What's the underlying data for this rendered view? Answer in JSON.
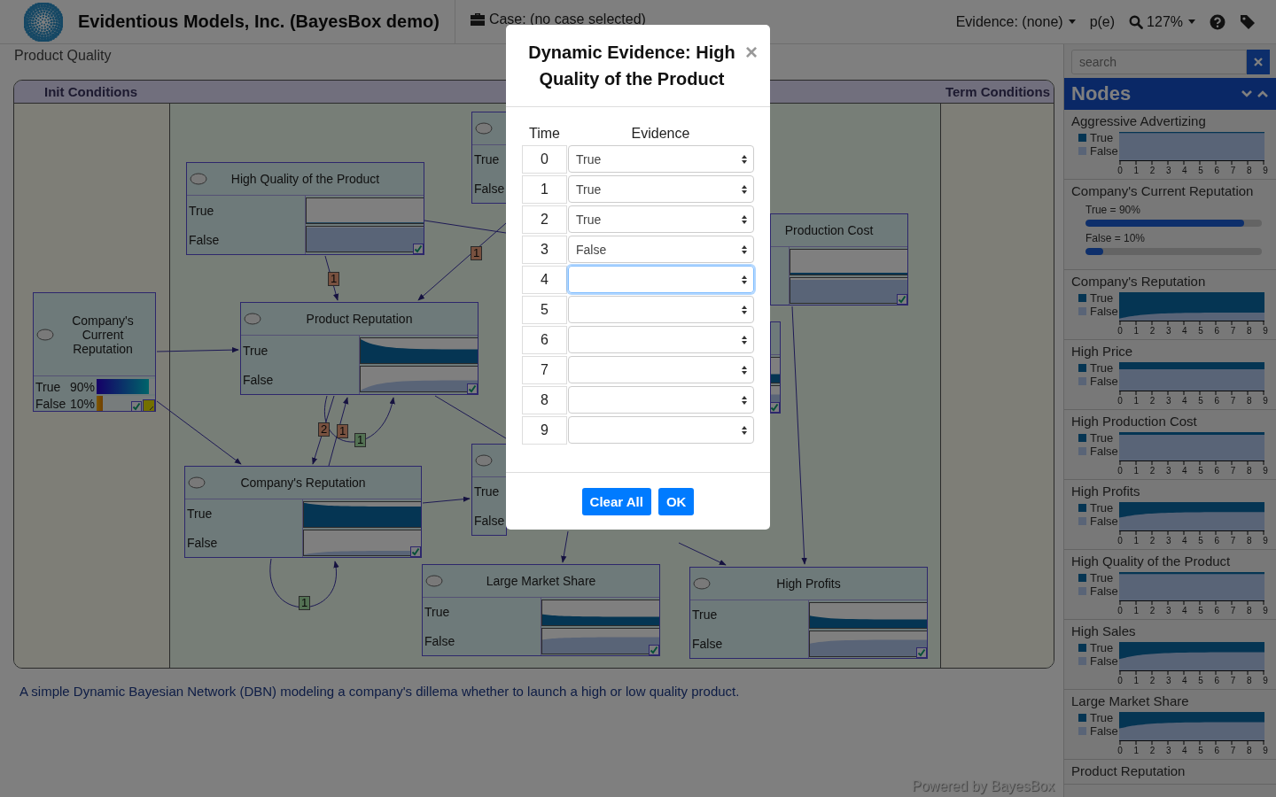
{
  "header": {
    "title": "Evidentious Models, Inc. (BayesBox demo)",
    "case": "Case: (no case selected)",
    "evidence": "Evidence: (none)",
    "pe": "p(e)",
    "zoom": "127%"
  },
  "breadcrumb": "Product Quality",
  "canvas": {
    "init_label": "Init Conditions",
    "term_label": "Term Conditions",
    "nodes": [
      {
        "kind": "chart",
        "title": "High Quality of the Product",
        "states": [
          {
            "label": "True"
          },
          {
            "label": "False"
          }
        ]
      },
      {
        "kind": "chart",
        "states": [
          {
            "label": "True"
          },
          {
            "label": "False"
          }
        ]
      },
      {
        "kind": "chart",
        "title": "Production Cost"
      },
      {
        "kind": "chart"
      },
      {
        "kind": "bars",
        "title": "Company's Current Reputation",
        "states": [
          {
            "label": "True",
            "value": "90%",
            "level": 0.9
          },
          {
            "label": "False",
            "value": "10%",
            "level": 0.1
          }
        ]
      },
      {
        "kind": "chart",
        "title": "Product Reputation",
        "states": [
          {
            "label": "True"
          },
          {
            "label": "False"
          }
        ]
      },
      {
        "kind": "chart",
        "title": "Company's Reputation",
        "states": [
          {
            "label": "True"
          },
          {
            "label": "False"
          }
        ]
      },
      {
        "kind": "chart",
        "states": [
          {
            "label": "True"
          },
          {
            "label": "False"
          }
        ]
      },
      {
        "kind": "chart",
        "title": "Large Market Share",
        "states": [
          {
            "label": "True"
          },
          {
            "label": "False"
          }
        ]
      },
      {
        "kind": "chart",
        "title": "High Profits",
        "states": [
          {
            "label": "True"
          },
          {
            "label": "False"
          }
        ]
      }
    ],
    "edge_labels": [
      {
        "text": "1",
        "kind": "temporal"
      },
      {
        "text": "1",
        "kind": "temporal"
      },
      {
        "text": "2",
        "kind": "temporal"
      },
      {
        "text": "1",
        "kind": "temporal"
      },
      {
        "text": "1",
        "kind": "loop"
      },
      {
        "text": "1",
        "kind": "loop"
      }
    ]
  },
  "description": "A simple Dynamic Bayesian Network (DBN) modeling a company's dillema whether to launch a high or low quality product.",
  "footer": "Powered by BayesBox",
  "sidebar": {
    "search": {
      "placeholder": "search"
    },
    "title": "Nodes",
    "items": [
      {
        "kind": "chart",
        "title": "Aggressive Advertizing",
        "legend": [
          "True",
          "False"
        ],
        "ticks": [
          "0",
          "1",
          "2",
          "3",
          "4",
          "5",
          "6",
          "7",
          "8",
          "9"
        ]
      },
      {
        "kind": "bars",
        "title": "Company's Current Reputation",
        "bars": [
          {
            "label": "True = 90%",
            "level": 0.9
          },
          {
            "label": "False = 10%",
            "level": 0.1
          }
        ]
      },
      {
        "kind": "chart",
        "title": "Company's Reputation",
        "legend": [
          "True",
          "False"
        ],
        "ticks": [
          "0",
          "1",
          "2",
          "3",
          "4",
          "5",
          "6",
          "7",
          "8",
          "9"
        ]
      },
      {
        "kind": "chart",
        "title": "High Price",
        "legend": [
          "True",
          "False"
        ],
        "ticks": [
          "0",
          "1",
          "2",
          "3",
          "4",
          "5",
          "6",
          "7",
          "8",
          "9"
        ]
      },
      {
        "kind": "chart",
        "title": "High Production Cost",
        "legend": [
          "True",
          "False"
        ],
        "ticks": [
          "0",
          "1",
          "2",
          "3",
          "4",
          "5",
          "6",
          "7",
          "8",
          "9"
        ]
      },
      {
        "kind": "chart",
        "title": "High Profits",
        "legend": [
          "True",
          "False"
        ],
        "ticks": [
          "0",
          "1",
          "2",
          "3",
          "4",
          "5",
          "6",
          "7",
          "8",
          "9"
        ]
      },
      {
        "kind": "chart",
        "title": "High Quality of the Product",
        "legend": [
          "True",
          "False"
        ],
        "ticks": [
          "0",
          "1",
          "2",
          "3",
          "4",
          "5",
          "6",
          "7",
          "8",
          "9"
        ]
      },
      {
        "kind": "chart",
        "title": "High Sales",
        "legend": [
          "True",
          "False"
        ],
        "ticks": [
          "0",
          "1",
          "2",
          "3",
          "4",
          "5",
          "6",
          "7",
          "8",
          "9"
        ]
      },
      {
        "kind": "chart",
        "title": "Large Market Share",
        "legend": [
          "True",
          "False"
        ],
        "ticks": [
          "0",
          "1",
          "2",
          "3",
          "4",
          "5",
          "6",
          "7",
          "8",
          "9"
        ]
      },
      {
        "kind": "chart",
        "title": "Product Reputation"
      }
    ]
  },
  "modal": {
    "title": "Dynamic Evidence: High Quality of the Product",
    "close": "×",
    "columns": [
      "Time",
      "Evidence"
    ],
    "rows": [
      {
        "time": "0",
        "value": "True",
        "focused": false
      },
      {
        "time": "1",
        "value": "True",
        "focused": false
      },
      {
        "time": "2",
        "value": "True",
        "focused": false
      },
      {
        "time": "3",
        "value": "False",
        "focused": false
      },
      {
        "time": "4",
        "focused": true
      },
      {
        "time": "5",
        "focused": false
      },
      {
        "time": "6",
        "focused": false
      },
      {
        "time": "7",
        "focused": false
      },
      {
        "time": "8",
        "focused": false
      },
      {
        "time": "9",
        "focused": false
      }
    ],
    "buttons": [
      "Clear All",
      "OK"
    ]
  }
}
